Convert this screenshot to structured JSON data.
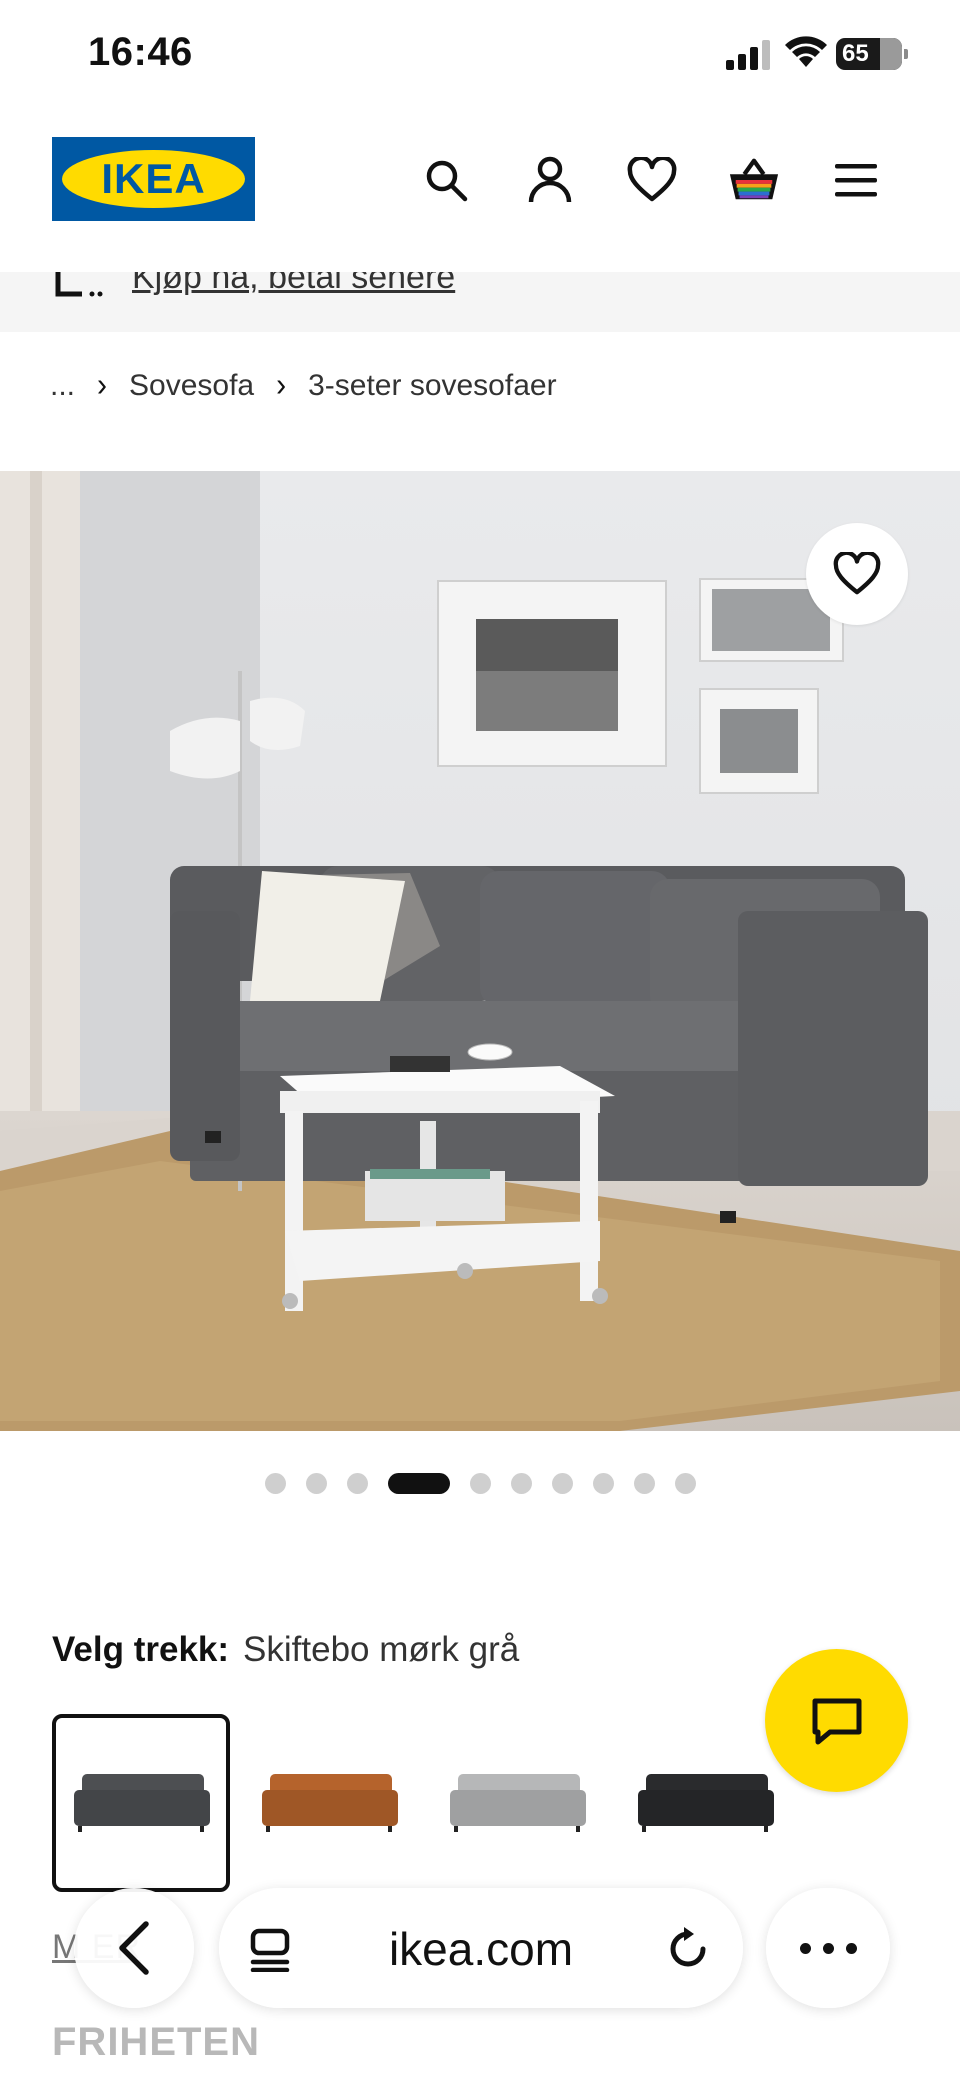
{
  "status_bar": {
    "time": "16:46",
    "battery": "65",
    "battery_level": 0.65
  },
  "header": {
    "logo_text": "IKEA",
    "icons": [
      "search-icon",
      "account-icon",
      "heart-icon",
      "cart-icon",
      "menu-icon"
    ]
  },
  "promo": {
    "text": "Kjøp nå, betal senere"
  },
  "breadcrumb": {
    "ellipsis": "...",
    "items": [
      "Sovesofa",
      "3-seter sovesofaer"
    ]
  },
  "gallery": {
    "dot_count": 10,
    "active_index": 3
  },
  "variant": {
    "label": "Velg trekk:",
    "value": "Skiftebo mørk grå",
    "swatches": [
      {
        "name": "dark-grey",
        "color": "#4d4f52",
        "selected": true
      },
      {
        "name": "orange",
        "color": "#b5632c",
        "selected": false
      },
      {
        "name": "light-grey",
        "color": "#b6b7b8",
        "selected": false
      },
      {
        "name": "black",
        "color": "#2a2b2d",
        "selected": false
      }
    ]
  },
  "below": {
    "partial_link": "M          ER",
    "product_name": "FRIHETEN"
  },
  "browser": {
    "url": "ikea.com"
  },
  "colors": {
    "ikea_blue": "#0058a3",
    "ikea_yellow": "#ffdb00"
  }
}
